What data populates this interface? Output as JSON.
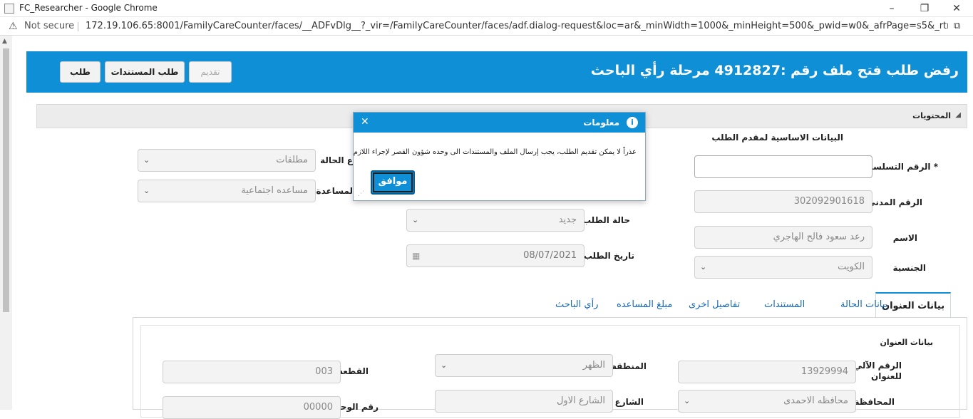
{
  "window": {
    "title": "FC_Researcher - Google Chrome",
    "minimize": "–",
    "maximize": "❐",
    "close": "✕"
  },
  "address": {
    "security": "Not secure",
    "url": "172.19.106.65:8001/FamilyCareCounter/faces/__ADFvDlg__?_vir=/FamilyCareCounter/faces/adf.dialog-request&loc=ar&_minWidth=1000&_minHeight=500&_pwid=w0&_afrPage=s5&_rtrnId=16..."
  },
  "header": {
    "title": "رفض طلب فتح ملف رقم :4912827 مرحلة رأي الباحث",
    "btn_submit": "تقديم",
    "btn_docs": "طلب المستندات",
    "btn_request": "طلب"
  },
  "contents": {
    "label": "المحتويات"
  },
  "basic": {
    "section": "البيانات الاساسية لمقدم الطلب",
    "serial_label": "* الرقم التسلسلي",
    "serial_value": "",
    "civil_label": "الرقم المدني",
    "civil_value": "302092901618",
    "name_label": "الاسم",
    "name_value": "رعد سعود فالح الهاجري",
    "nationality_label": "الجنسية",
    "nationality_value": "الكويت",
    "status_label": "حالة الطلب",
    "status_value": "جديد",
    "date_label": "تاريخ الطلب",
    "date_value": "08/07/2021",
    "case_type_label": "ع الحالة",
    "case_type_value": "مطلقات",
    "aid_label": "لمساعدة",
    "aid_value": "مساعده اجتماعية"
  },
  "tabs": [
    {
      "label": "بيانات العنوان"
    },
    {
      "label": "بيانات الحالة"
    },
    {
      "label": "المستندات"
    },
    {
      "label": "تفاصيل اخرى"
    },
    {
      "label": "مبلغ المساعده"
    },
    {
      "label": "رأي الباحث"
    }
  ],
  "address_panel": {
    "section": "بيانات العنوان",
    "auto_label": "الرقم الآلي للعنوان",
    "auto_value": "13929994",
    "region_label": "المنطقة",
    "region_value": "الظهر",
    "block_label": "القطعة",
    "block_value": "003",
    "governorate_label": "المحافظة",
    "governorate_value": "محافظه الاحمدى",
    "street_label": "الشارع",
    "street_value": "الشارع الاول",
    "unit_label": "رقم الوحدة",
    "unit_value": "00000"
  },
  "dialog": {
    "title": "معلومات",
    "message": "عذراً لا يمكن تقديم الطلب، يجب إرسال الملف والمستندات الى وحده شؤون القصر لإجراء اللازم",
    "ok": "موافق"
  }
}
